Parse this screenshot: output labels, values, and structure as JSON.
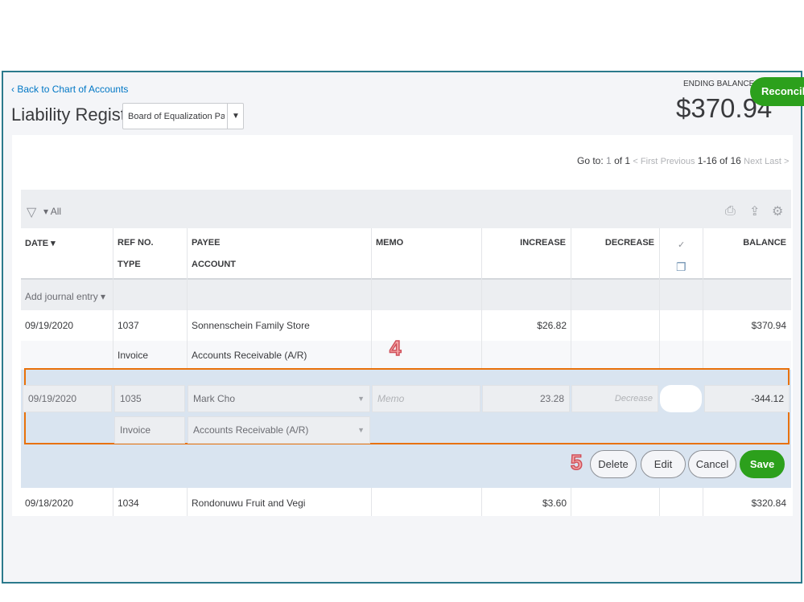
{
  "header": {
    "back_link": "Back to Chart of Accounts",
    "title": "Liability Register",
    "account_select": "Board of Equalization Payat",
    "ending_balance_label": "ENDING BALANCE",
    "ending_balance": "$370.94",
    "reconcile": "Reconcile"
  },
  "pagination": {
    "goto": "Go to:",
    "page": "1",
    "of": "of 1",
    "first": "< First",
    "previous": "Previous",
    "range": "1-16 of 16",
    "next": "Next",
    "last": "Last >"
  },
  "filter": {
    "label": "▾ All"
  },
  "columns": {
    "date": "DATE ▾",
    "ref": "REF NO.",
    "type": "TYPE",
    "payee": "PAYEE",
    "account": "ACCOUNT",
    "memo": "MEMO",
    "increase": "INCREASE",
    "decrease": "DECREASE",
    "check": "✓",
    "balance": "BALANCE"
  },
  "add_journal": "Add journal entry ▾",
  "rows": [
    {
      "date": "09/19/2020",
      "ref": "1037",
      "payee": "Sonnenschein Family Store",
      "increase": "$26.82",
      "balance": "$370.94",
      "type": "Invoice",
      "account": "Accounts Receivable (A/R)"
    },
    {
      "date": "09/18/2020",
      "ref": "1034",
      "payee": "Rondonuwu Fruit and Vegi",
      "increase": "$3.60",
      "balance": "$320.84"
    }
  ],
  "edit_row": {
    "date": "09/19/2020",
    "ref": "1035",
    "payee": "Mark Cho",
    "memo_placeholder": "Memo",
    "increase": "23.28",
    "decrease_placeholder": "Decrease",
    "balance": "-344.12",
    "type": "Invoice",
    "account": "Accounts Receivable (A/R)"
  },
  "actions": {
    "delete": "Delete",
    "edit": "Edit",
    "cancel": "Cancel",
    "save": "Save"
  },
  "annotations": {
    "step4": "4",
    "step5": "5"
  },
  "colors": {
    "accent": "#0077c5",
    "save": "#2ca01c",
    "highlight": "#e8710a"
  }
}
